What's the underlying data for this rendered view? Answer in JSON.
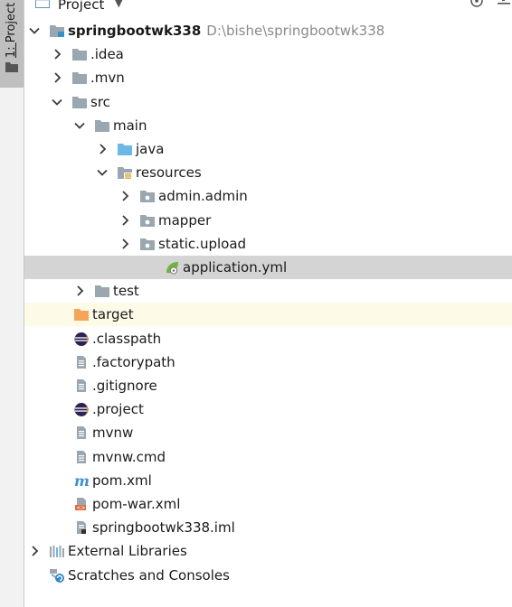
{
  "side_panel": {
    "tab_label_prefix": "1: ",
    "tab_label_text": "Project"
  },
  "header": {
    "title": "Project",
    "dropdown_icon": "caret-down-icon",
    "actions": [
      "target-icon",
      "settings-icon"
    ]
  },
  "tree": [
    {
      "id": "root",
      "label": "springbootwk338",
      "path": "D:\\bishe\\springbootwk338",
      "depth": 0,
      "expanded": true,
      "icon": "module-folder-icon",
      "bold": true
    },
    {
      "id": "idea",
      "label": ".idea",
      "depth": 1,
      "expanded": false,
      "icon": "folder-icon"
    },
    {
      "id": "mvn",
      "label": ".mvn",
      "depth": 1,
      "expanded": false,
      "icon": "folder-icon"
    },
    {
      "id": "src",
      "label": "src",
      "depth": 1,
      "expanded": true,
      "icon": "folder-icon"
    },
    {
      "id": "main",
      "label": "main",
      "depth": 2,
      "expanded": true,
      "icon": "folder-icon"
    },
    {
      "id": "java",
      "label": "java",
      "depth": 3,
      "expanded": false,
      "icon": "source-folder-icon"
    },
    {
      "id": "resources",
      "label": "resources",
      "depth": 3,
      "expanded": true,
      "icon": "resources-folder-icon"
    },
    {
      "id": "admin",
      "label": "admin.admin",
      "depth": 4,
      "expanded": false,
      "icon": "package-icon"
    },
    {
      "id": "mapper",
      "label": "mapper",
      "depth": 4,
      "expanded": false,
      "icon": "package-icon"
    },
    {
      "id": "static",
      "label": "static.upload",
      "depth": 4,
      "expanded": false,
      "icon": "package-icon"
    },
    {
      "id": "appyml",
      "label": "application.yml",
      "depth": 5,
      "icon": "spring-config-icon",
      "selected": true
    },
    {
      "id": "test",
      "label": "test",
      "depth": 2,
      "expanded": false,
      "icon": "folder-icon"
    },
    {
      "id": "target",
      "label": "target",
      "depth": 1,
      "icon": "excluded-folder-icon",
      "highlight": true
    },
    {
      "id": "classpath",
      "label": ".classpath",
      "depth": 1,
      "icon": "eclipse-icon"
    },
    {
      "id": "factorypath",
      "label": ".factorypath",
      "depth": 1,
      "icon": "text-file-icon"
    },
    {
      "id": "gitignore",
      "label": ".gitignore",
      "depth": 1,
      "icon": "text-file-icon"
    },
    {
      "id": "project",
      "label": ".project",
      "depth": 1,
      "icon": "eclipse-icon"
    },
    {
      "id": "mvnw",
      "label": "mvnw",
      "depth": 1,
      "icon": "text-file-icon"
    },
    {
      "id": "mvnwcmd",
      "label": "mvnw.cmd",
      "depth": 1,
      "icon": "text-file-icon"
    },
    {
      "id": "pom",
      "label": "pom.xml",
      "depth": 1,
      "icon": "maven-icon"
    },
    {
      "id": "pomwar",
      "label": "pom-war.xml",
      "depth": 1,
      "icon": "xml-file-icon"
    },
    {
      "id": "iml",
      "label": "springbootwk338.iml",
      "depth": 1,
      "icon": "iml-file-icon"
    },
    {
      "id": "extlib",
      "label": "External Libraries",
      "depth": 0,
      "expanded": false,
      "icon": "libraries-icon"
    },
    {
      "id": "scratch",
      "label": "Scratches and Consoles",
      "depth": 0,
      "icon": "scratches-icon"
    }
  ],
  "colors": {
    "folder": "#9aa7b0",
    "source_folder": "#6cb8e6",
    "excluded_folder": "#f5a55a",
    "selected_row": "#d4d4d4",
    "highlight_row": "#fdfbe7",
    "path_text": "#8a8a8a"
  }
}
